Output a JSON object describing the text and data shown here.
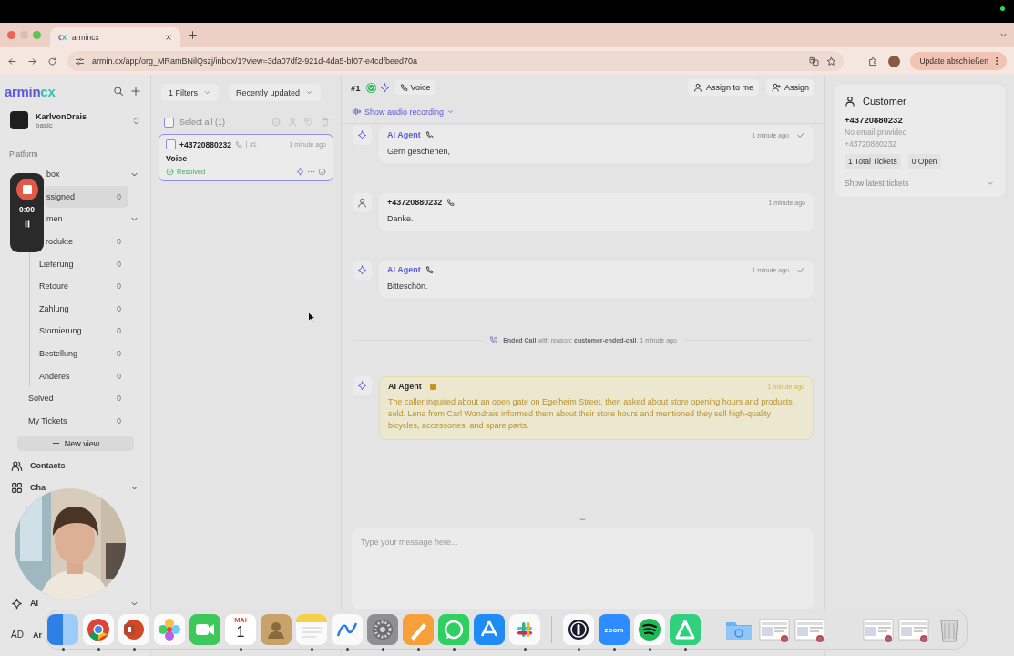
{
  "browser": {
    "tab_title": "armincx",
    "url": "armin.cx/app/org_MRamBNilQszj/inbox/1?view=3da07df2-921d-4da5-bf07-e4cdfbeed70a",
    "update_button": "Update abschließen"
  },
  "recorder": {
    "time": "0:00"
  },
  "sidebar": {
    "logo": {
      "name": "armin",
      "suffix": "cx"
    },
    "workspace": {
      "name": "KarlvonDrais",
      "plan": "basic"
    },
    "section": "Platform",
    "tree": [
      {
        "label": "box",
        "selected": false,
        "expanded": true,
        "children": [
          {
            "label": "ssigned",
            "count": "0",
            "selected": true
          },
          {
            "label": "men",
            "selected": false,
            "expanded": true,
            "children": [
              {
                "label": "rodukte",
                "count": "0",
                "selected": false
              },
              {
                "label": "Lieferung",
                "count": "0",
                "selected": false
              },
              {
                "label": "Retoure",
                "count": "0",
                "selected": false
              },
              {
                "label": "Zahlung",
                "count": "0",
                "selected": false
              },
              {
                "label": "Stornierung",
                "count": "0",
                "selected": false
              },
              {
                "label": "Bestellung",
                "count": "0",
                "selected": false
              },
              {
                "label": "Anderes",
                "count": "0",
                "selected": false
              }
            ]
          },
          {
            "label": "Solved",
            "count": "0",
            "selected": false
          },
          {
            "label": "My Tickets",
            "count": "0",
            "selected": false
          }
        ]
      }
    ],
    "new_view_button": "New view",
    "nav": [
      {
        "label": "Contacts"
      },
      {
        "label": "Cha",
        "expanded": true
      },
      {
        "label": "AI",
        "expanded": true
      }
    ],
    "user": {
      "initials": "AD",
      "name": "Ar"
    }
  },
  "ticket_list": {
    "filters_button": "1 Filters",
    "sort_button": "Recently updated",
    "select_all": {
      "label": "Select all (1)",
      "checked": false
    },
    "tickets": [
      {
        "phone": "+43720880232",
        "number": "#1",
        "time": "1 minute ago",
        "title": "Voice",
        "status": "Resolved",
        "selected": true,
        "checked": false
      }
    ]
  },
  "conversation": {
    "number": "#1",
    "channel": "Voice",
    "buttons": [
      "Assign to me",
      "Assign"
    ],
    "audio_toggle": "Show audio recording",
    "messages": [
      {
        "kind": "agent",
        "sender": "AI Agent",
        "time": "1 minute ago",
        "text": "Gern geschehen,",
        "delivered": true
      },
      {
        "kind": "customer",
        "sender": "+43720880232",
        "time": "1 minute ago",
        "text": "Danke.",
        "delivered": false
      },
      {
        "kind": "agent",
        "sender": "AI Agent",
        "time": "1 minute ago",
        "text": "Bitteschön.",
        "delivered": true
      },
      {
        "kind": "event",
        "text": "**Ended Call** with reason: **customer-ended-call**, 1 minute ago"
      },
      {
        "kind": "note",
        "sender": "AI Agent",
        "time": "1 minute ago",
        "text": "The caller inquired about an open gate on Egelheim Street, then asked about store opening hours and products sold. Lena from Carl Wondrais informed them about their store hours and mentioned they sell high-quality bicycles, accessories, and spare parts."
      }
    ],
    "composer_placeholder": "Type your message here..."
  },
  "customer": {
    "title": "Customer",
    "name": "+43720880232",
    "email": "No email provided",
    "phone": "+43720880232",
    "badges": [
      "1 Total Tickets",
      "0 Open"
    ],
    "toggle": "Show latest tickets"
  },
  "dock": {
    "items": [
      {
        "kind": "finder",
        "running": true
      },
      {
        "kind": "chrome",
        "running": true
      },
      {
        "kind": "slides",
        "running": true
      },
      {
        "kind": "photos",
        "running": false
      },
      {
        "kind": "facetime",
        "running": false
      },
      {
        "kind": "calendar",
        "month": "MAI",
        "day": "1",
        "running": true
      },
      {
        "kind": "contacts",
        "running": false
      },
      {
        "kind": "notes",
        "running": true
      },
      {
        "kind": "freeform",
        "running": true
      },
      {
        "kind": "settings",
        "running": true
      },
      {
        "kind": "pen",
        "running": true
      },
      {
        "kind": "whatsapp",
        "running": true
      },
      {
        "kind": "appstore",
        "running": false
      },
      {
        "kind": "slack",
        "running": true
      },
      {
        "kind": "separator"
      },
      {
        "kind": "keyhole",
        "running": true
      },
      {
        "kind": "zoom",
        "label": "zoom",
        "running": true
      },
      {
        "kind": "spotify",
        "running": true
      },
      {
        "kind": "greenapp",
        "running": true
      },
      {
        "kind": "separator"
      },
      {
        "kind": "folder"
      },
      {
        "kind": "thumbnail"
      },
      {
        "kind": "thumbnail"
      },
      {
        "kind": "thumbnail"
      },
      {
        "kind": "thumbnail"
      },
      {
        "kind": "trash"
      }
    ]
  }
}
